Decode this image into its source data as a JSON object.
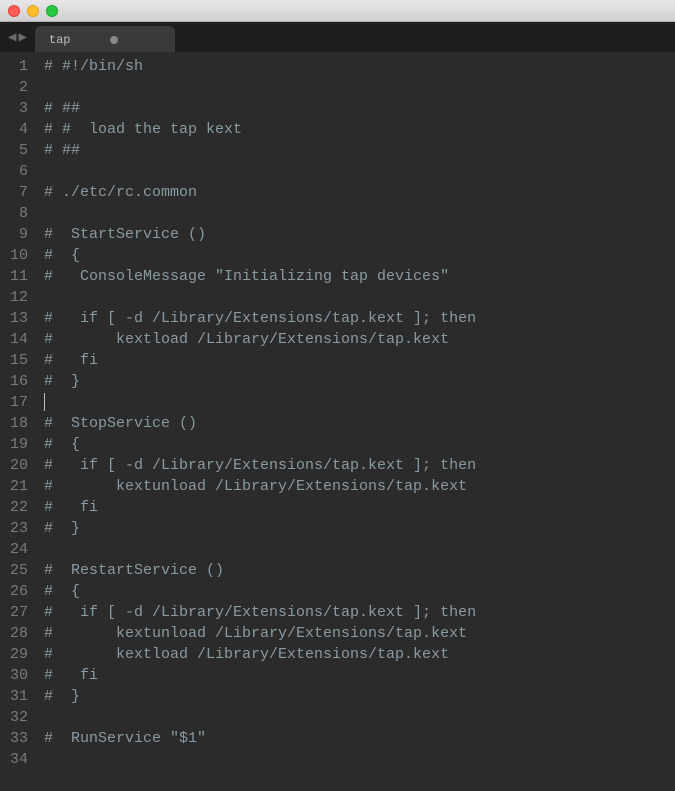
{
  "titlebar": {
    "close": "close",
    "minimize": "minimize",
    "maximize": "maximize"
  },
  "nav": {
    "back": "◀",
    "forward": "▶"
  },
  "tab": {
    "name": "tap"
  },
  "code": {
    "lines": [
      {
        "n": "1",
        "text": "# #!/bin/sh",
        "cls": "comment"
      },
      {
        "n": "2",
        "text": "",
        "cls": ""
      },
      {
        "n": "3",
        "text": "# ##",
        "cls": "comment"
      },
      {
        "n": "4",
        "text": "# #  load the tap kext",
        "cls": "comment"
      },
      {
        "n": "5",
        "text": "# ##",
        "cls": "comment"
      },
      {
        "n": "6",
        "text": "",
        "cls": ""
      },
      {
        "n": "7",
        "text": "# ./etc/rc.common",
        "cls": "comment"
      },
      {
        "n": "8",
        "text": "",
        "cls": ""
      },
      {
        "n": "9",
        "text": "#  StartService ()",
        "cls": "comment"
      },
      {
        "n": "10",
        "text": "#  {",
        "cls": "comment"
      },
      {
        "n": "11",
        "text": "#   ConsoleMessage \"Initializing tap devices\"",
        "cls": "comment"
      },
      {
        "n": "12",
        "text": "",
        "cls": ""
      },
      {
        "n": "13",
        "text": "#   if [ -d /Library/Extensions/tap.kext ]; then",
        "cls": "comment"
      },
      {
        "n": "14",
        "text": "#       kextload /Library/Extensions/tap.kext",
        "cls": "comment"
      },
      {
        "n": "15",
        "text": "#   fi",
        "cls": "comment"
      },
      {
        "n": "16",
        "text": "#  }",
        "cls": "comment"
      },
      {
        "n": "17",
        "text": "",
        "cls": "",
        "cursor": true
      },
      {
        "n": "18",
        "text": "#  StopService ()",
        "cls": "comment"
      },
      {
        "n": "19",
        "text": "#  {",
        "cls": "comment"
      },
      {
        "n": "20",
        "text": "#   if [ -d /Library/Extensions/tap.kext ]; then",
        "cls": "comment"
      },
      {
        "n": "21",
        "text": "#       kextunload /Library/Extensions/tap.kext",
        "cls": "comment"
      },
      {
        "n": "22",
        "text": "#   fi",
        "cls": "comment"
      },
      {
        "n": "23",
        "text": "#  }",
        "cls": "comment"
      },
      {
        "n": "24",
        "text": "",
        "cls": ""
      },
      {
        "n": "25",
        "text": "#  RestartService ()",
        "cls": "comment"
      },
      {
        "n": "26",
        "text": "#  {",
        "cls": "comment"
      },
      {
        "n": "27",
        "text": "#   if [ -d /Library/Extensions/tap.kext ]; then",
        "cls": "comment"
      },
      {
        "n": "28",
        "text": "#       kextunload /Library/Extensions/tap.kext",
        "cls": "comment"
      },
      {
        "n": "29",
        "text": "#       kextload /Library/Extensions/tap.kext",
        "cls": "comment"
      },
      {
        "n": "30",
        "text": "#   fi",
        "cls": "comment"
      },
      {
        "n": "31",
        "text": "#  }",
        "cls": "comment"
      },
      {
        "n": "32",
        "text": "",
        "cls": ""
      },
      {
        "n": "33",
        "text": "#  RunService \"$1\"",
        "cls": "comment"
      },
      {
        "n": "34",
        "text": "",
        "cls": ""
      }
    ]
  }
}
